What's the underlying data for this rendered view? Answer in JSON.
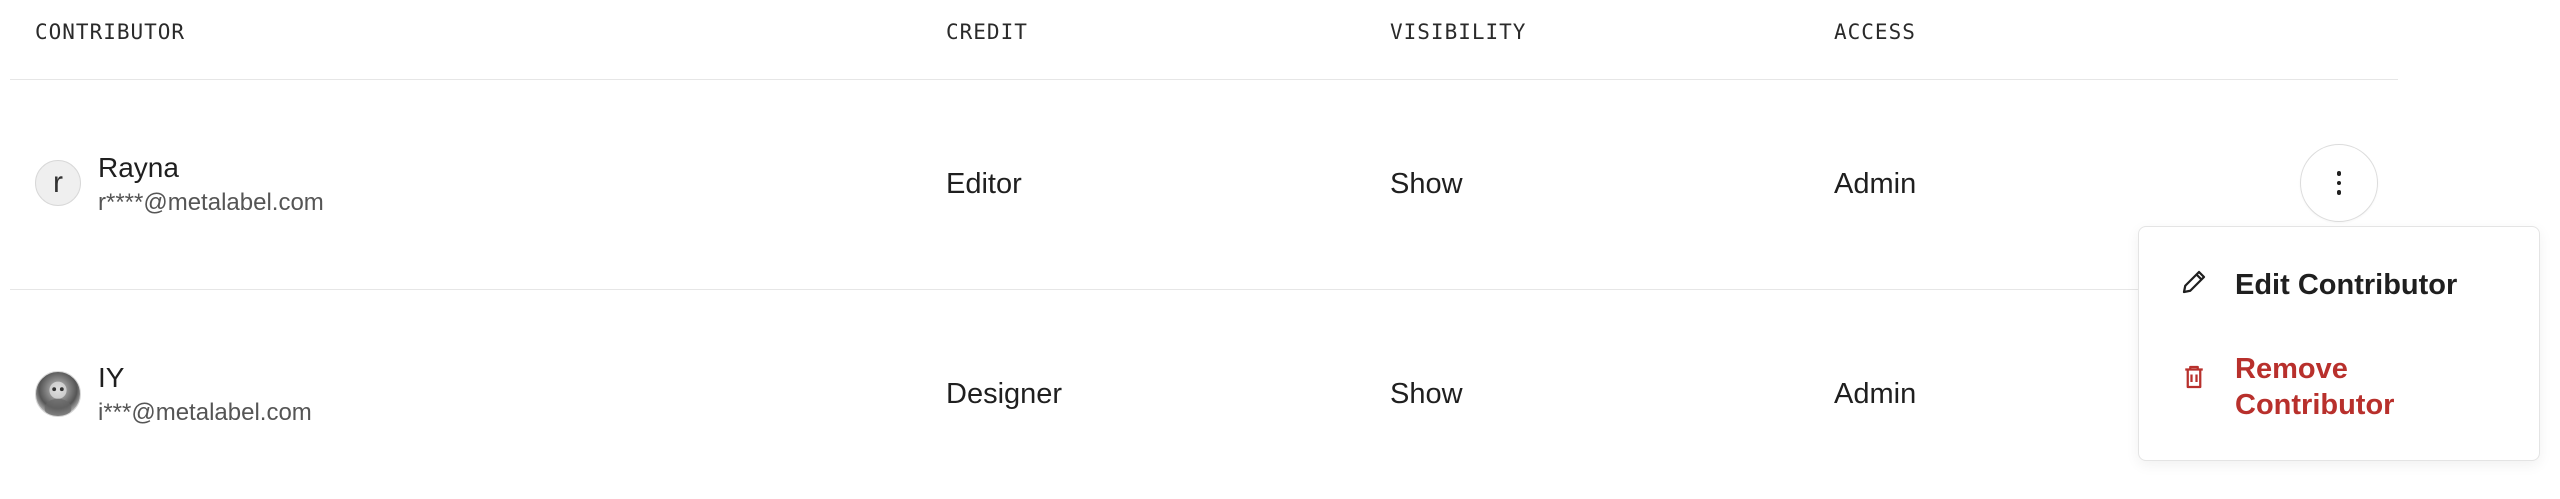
{
  "table": {
    "headers": {
      "contributor": "CONTRIBUTOR",
      "credit": "CREDIT",
      "visibility": "VISIBILITY",
      "access": "ACCESS"
    },
    "rows": [
      {
        "avatar_initial": "r",
        "name": "Rayna",
        "email": "r****@metalabel.com",
        "credit": "Editor",
        "visibility": "Show",
        "access": "Admin"
      },
      {
        "avatar_initial": "",
        "name": "IY",
        "email": "i***@metalabel.com",
        "credit": "Designer",
        "visibility": "Show",
        "access": "Admin"
      }
    ]
  },
  "menu": {
    "edit_label": "Edit Contributor",
    "remove_label": "Remove Contributor",
    "edit_icon": "pencil-icon",
    "remove_icon": "trash-icon"
  },
  "colors": {
    "danger": "#b8302c",
    "border": "#e6e6e6",
    "text": "#1f1f1f"
  }
}
